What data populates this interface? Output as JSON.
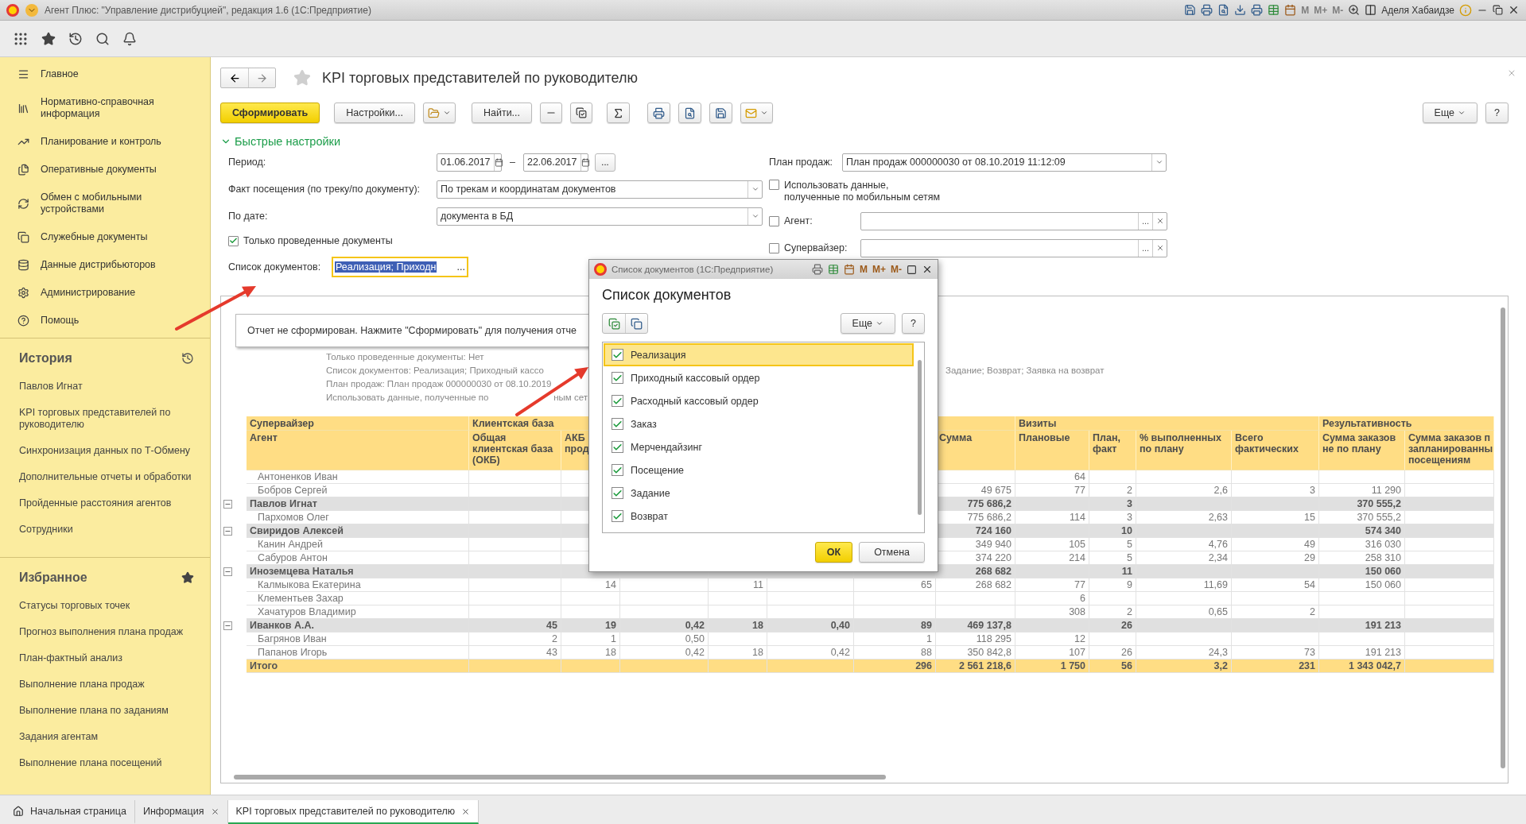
{
  "window": {
    "title": "Агент Плюс: \"Управление дистрибуцией\", редакция 1.6  (1С:Предприятие)",
    "user": "Аделя Хабаидзе",
    "memory_buttons": [
      {
        "label": "M",
        "disabled": true
      },
      {
        "label": "M+",
        "disabled": true
      },
      {
        "label": "M-",
        "disabled": true
      }
    ]
  },
  "sidebar": {
    "nav": [
      "Главное",
      "Нормативно-справочная информация",
      "Планирование и контроль",
      "Оперативные документы",
      "Обмен с мобильными устройствами",
      "Служебные документы",
      "Данные дистрибьюторов",
      "Администрирование",
      "Помощь"
    ],
    "history": {
      "title": "История",
      "items": [
        "Павлов Игнат",
        "KPI торговых представителей по руководителю",
        "Синхронизация данных по Т-Обмену",
        "Дополнительные отчеты и обработки",
        "Пройденные расстояния агентов",
        "Сотрудники"
      ]
    },
    "favorites": {
      "title": "Избранное",
      "items": [
        "Статусы торговых точек",
        "Прогноз выполнения плана продаж",
        "План-фактный анализ",
        "Выполнение плана продаж",
        "Выполнение плана по заданиям",
        "Задания агентам",
        "Выполнение плана посещений"
      ]
    }
  },
  "page": {
    "title": "KPI торговых представителей по руководителю",
    "generate": "Сформировать",
    "settings": "Настройки...",
    "find": "Найти...",
    "more": "Еще",
    "help": "?"
  },
  "quick_settings": {
    "title": "Быстрые настройки",
    "expanded": true,
    "period": {
      "label": "Период:",
      "from": "01.06.2017",
      "dash": "–",
      "to": "22.06.2017",
      "more": "..."
    },
    "visit_fact": {
      "label": "Факт посещения (по треку/по документу):",
      "value": "По трекам и координатам документов"
    },
    "by_date": {
      "label": "По дате:",
      "value": "документа в БД"
    },
    "posted_only": {
      "label": "Только проведенные документы",
      "checked": true
    },
    "doc_list": {
      "label": "Список документов:",
      "value": "Реализация; Приходн",
      "more": "..."
    },
    "sales_plan": {
      "label": "План продаж:",
      "value": "План продаж 000000030 от 08.10.2019 11:12:09"
    },
    "mobile_data": {
      "label": "Использовать данные,\nполученные по мобильным сетям",
      "checked": false
    },
    "agent": {
      "label": "Агент:",
      "checked": false,
      "more": "..."
    },
    "supervisor": {
      "label": "Супервайзер:",
      "checked": false,
      "more": "..."
    }
  },
  "report": {
    "notice": "Отчет не сформирован. Нажмите \"Сформировать\" для получения отче",
    "header_lines": [
      {
        "text": "Только проведенные документы: Нет"
      },
      {
        "text": "Список документов: Реализация; Приходный кассо",
        "tail": "Задание; Возврат; Заявка на возврат"
      },
      {
        "text": "План продаж: План продаж 000000030 от 08.10.2019"
      },
      {
        "text": "Использовать данные, полученные по",
        "after": "ным сет"
      }
    ],
    "groups": [
      "Супервайзер",
      "Клиентская база",
      "Визиты",
      "Результативность"
    ],
    "columns": [
      "Агент",
      "Общая клиентская база (ОКБ)",
      "АКБ прод",
      "",
      "",
      "",
      "",
      "Сумма",
      "Плановые",
      "План, факт",
      "% выполненных по плану",
      "Всего фактических",
      "Сумма заказов не по плану",
      "Сумма заказов п\nзапланированны\nпосещениям"
    ],
    "rows": [
      {
        "kind": "agent",
        "cells": [
          "Антоненков Иван",
          "",
          "",
          "",
          "",
          "",
          "",
          "",
          "64",
          "",
          "",
          "",
          "",
          ""
        ]
      },
      {
        "kind": "agent",
        "cells": [
          "Бобров Сергей",
          "",
          "",
          "",
          "",
          "",
          "",
          "49 675",
          "77",
          "2",
          "2,6",
          "3",
          "11 290",
          ""
        ]
      },
      {
        "kind": "group",
        "expanded": true,
        "cells": [
          "Павлов Игнат",
          "",
          "",
          "",
          "",
          "",
          "",
          "775 686,2",
          "",
          "3",
          "",
          "",
          "370 555,2",
          ""
        ]
      },
      {
        "kind": "agent",
        "cells": [
          "Пархомов Олег",
          "",
          "",
          "",
          "",
          "",
          "",
          "775 686,2",
          "114",
          "3",
          "2,63",
          "15",
          "370 555,2",
          ""
        ]
      },
      {
        "kind": "group",
        "expanded": true,
        "cells": [
          "Свиридов Алексей",
          "",
          "",
          "",
          "",
          "",
          "",
          "724 160",
          "",
          "10",
          "",
          "",
          "574 340",
          ""
        ]
      },
      {
        "kind": "agent",
        "cells": [
          "Канин Андрей",
          "",
          "",
          "",
          "",
          "",
          "",
          "349 940",
          "105",
          "5",
          "4,76",
          "49",
          "316 030",
          ""
        ]
      },
      {
        "kind": "agent",
        "cells": [
          "Сабуров Антон",
          "",
          "",
          "",
          "",
          "",
          "",
          "374 220",
          "214",
          "5",
          "2,34",
          "29",
          "258 310",
          ""
        ]
      },
      {
        "kind": "group",
        "expanded": true,
        "cells": [
          "Иноземцева Наталья",
          "",
          "",
          "",
          "",
          "",
          "",
          "268 682",
          "",
          "11",
          "",
          "",
          "150 060",
          ""
        ]
      },
      {
        "kind": "agent",
        "cells": [
          "Калмыкова Екатерина",
          "",
          "14",
          "",
          "11",
          "",
          "65",
          "268 682",
          "77",
          "9",
          "11,69",
          "54",
          "150 060",
          ""
        ]
      },
      {
        "kind": "agent",
        "cells": [
          "Клементьев Захар",
          "",
          "",
          "",
          "",
          "",
          "",
          "",
          "6",
          "",
          "",
          "",
          "",
          ""
        ]
      },
      {
        "kind": "agent",
        "cells": [
          "Хачатуров Владимир",
          "",
          "",
          "",
          "",
          "",
          "",
          "",
          "308",
          "2",
          "0,65",
          "2",
          "",
          ""
        ]
      },
      {
        "kind": "group",
        "expanded": true,
        "cells": [
          "Иванков А.А.",
          "45",
          "19",
          "0,42",
          "18",
          "0,40",
          "89",
          "469 137,8",
          "",
          "26",
          "",
          "",
          "191 213",
          ""
        ]
      },
      {
        "kind": "agent",
        "cells": [
          "Багрянов Иван",
          "2",
          "1",
          "0,50",
          "",
          "",
          "1",
          "118 295",
          "12",
          "",
          "",
          "",
          "",
          ""
        ]
      },
      {
        "kind": "agent",
        "cells": [
          "Папанов Игорь",
          "43",
          "18",
          "0,42",
          "18",
          "0,42",
          "88",
          "350 842,8",
          "107",
          "26",
          "24,3",
          "73",
          "191 213",
          ""
        ]
      },
      {
        "kind": "total",
        "cells": [
          "Итого",
          "",
          "",
          "",
          "",
          "",
          "296",
          "2 561 218,6",
          "1 750",
          "56",
          "3,2",
          "231",
          "1 343 042,7",
          ""
        ]
      }
    ]
  },
  "dialog": {
    "title": "Список документов  (1С:Предприятие)",
    "heading": "Список документов",
    "more": "Еще",
    "help": "?",
    "memory_buttons": [
      {
        "label": "M",
        "disabled": false
      },
      {
        "label": "M+",
        "disabled": false
      },
      {
        "label": "M-",
        "disabled": false
      }
    ],
    "items": [
      {
        "label": "Реализация",
        "checked": true,
        "selected": true
      },
      {
        "label": "Приходный кассовый ордер",
        "checked": true,
        "selected": false
      },
      {
        "label": "Расходный кассовый ордер",
        "checked": true,
        "selected": false
      },
      {
        "label": "Заказ",
        "checked": true,
        "selected": false
      },
      {
        "label": "Мерчендайзинг",
        "checked": true,
        "selected": false
      },
      {
        "label": "Посещение",
        "checked": true,
        "selected": false
      },
      {
        "label": "Задание",
        "checked": true,
        "selected": false
      },
      {
        "label": "Возврат",
        "checked": true,
        "selected": false
      }
    ],
    "ok": "ОК",
    "cancel": "Отмена"
  },
  "tabs": [
    {
      "label": "Начальная страница",
      "selected": false,
      "closable": false
    },
    {
      "label": "Информация",
      "selected": false,
      "closable": true
    },
    {
      "label": "KPI торговых представителей по руководителю",
      "selected": true,
      "closable": true
    }
  ]
}
